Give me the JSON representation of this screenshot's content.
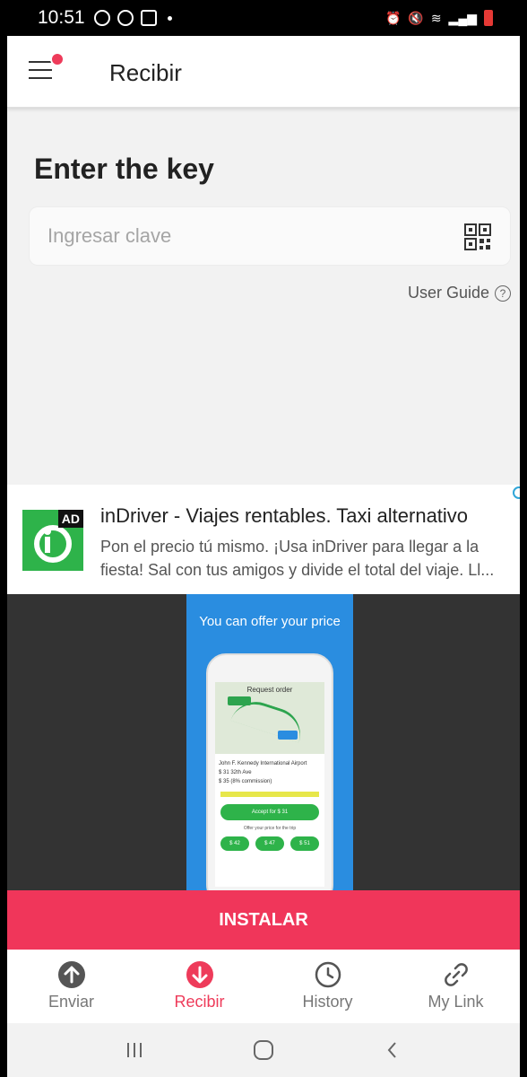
{
  "status_bar": {
    "time": "10:51",
    "icons_left": [
      "whatsapp-icon",
      "sync-icon",
      "message-icon",
      "dot-icon"
    ],
    "icons_right": [
      "alarm-icon",
      "mute-icon",
      "wifi-icon",
      "signal-icon",
      "battery-icon"
    ]
  },
  "app_bar": {
    "title": "Recibir",
    "menu_icon": "hamburger-icon",
    "notification_dot_color": "#ee3b5a"
  },
  "main": {
    "heading": "Enter the key",
    "key_input": {
      "placeholder": "Ingresar clave",
      "value": "",
      "scan_icon": "qr-code-icon"
    },
    "user_guide": {
      "label": "User Guide",
      "icon": "help-circle-icon"
    }
  },
  "ad": {
    "badge": "AD",
    "title": "inDriver - Viajes rentables. Taxi alternativo",
    "description": "Pon el precio tú mismo. ¡Usa inDriver para llegar a la fiesta! Sal con tus amigos y divide el total del viaje. Ll...",
    "media_caption": "You can offer your price",
    "logo_color": "#2eb34a",
    "media_bg": "#2a8de0",
    "cta_label": "INSTALAR",
    "cta_color": "#f0365a",
    "phone": {
      "screen_title": "Request order",
      "info_line_1": "John F. Kennedy International Airport",
      "info_line_2": "$ 31 32th Ave",
      "info_line_3": "$ 35 (8% commission)",
      "accept_label": "Accept for $ 31",
      "offer_label": "Offer your price for the trip",
      "prices": [
        "$ 42",
        "$ 47",
        "$ 51"
      ]
    }
  },
  "bottom_nav": {
    "items": [
      {
        "label": "Enviar",
        "icon": "upload-arrow-icon",
        "active": false
      },
      {
        "label": "Recibir",
        "icon": "download-arrow-icon",
        "active": true
      },
      {
        "label": "History",
        "icon": "clock-icon",
        "active": false
      },
      {
        "label": "My Link",
        "icon": "link-icon",
        "active": false
      }
    ],
    "active_color": "#ee3b5a"
  },
  "system_nav": {
    "buttons": [
      "recent-apps-icon",
      "home-icon",
      "back-icon"
    ]
  }
}
